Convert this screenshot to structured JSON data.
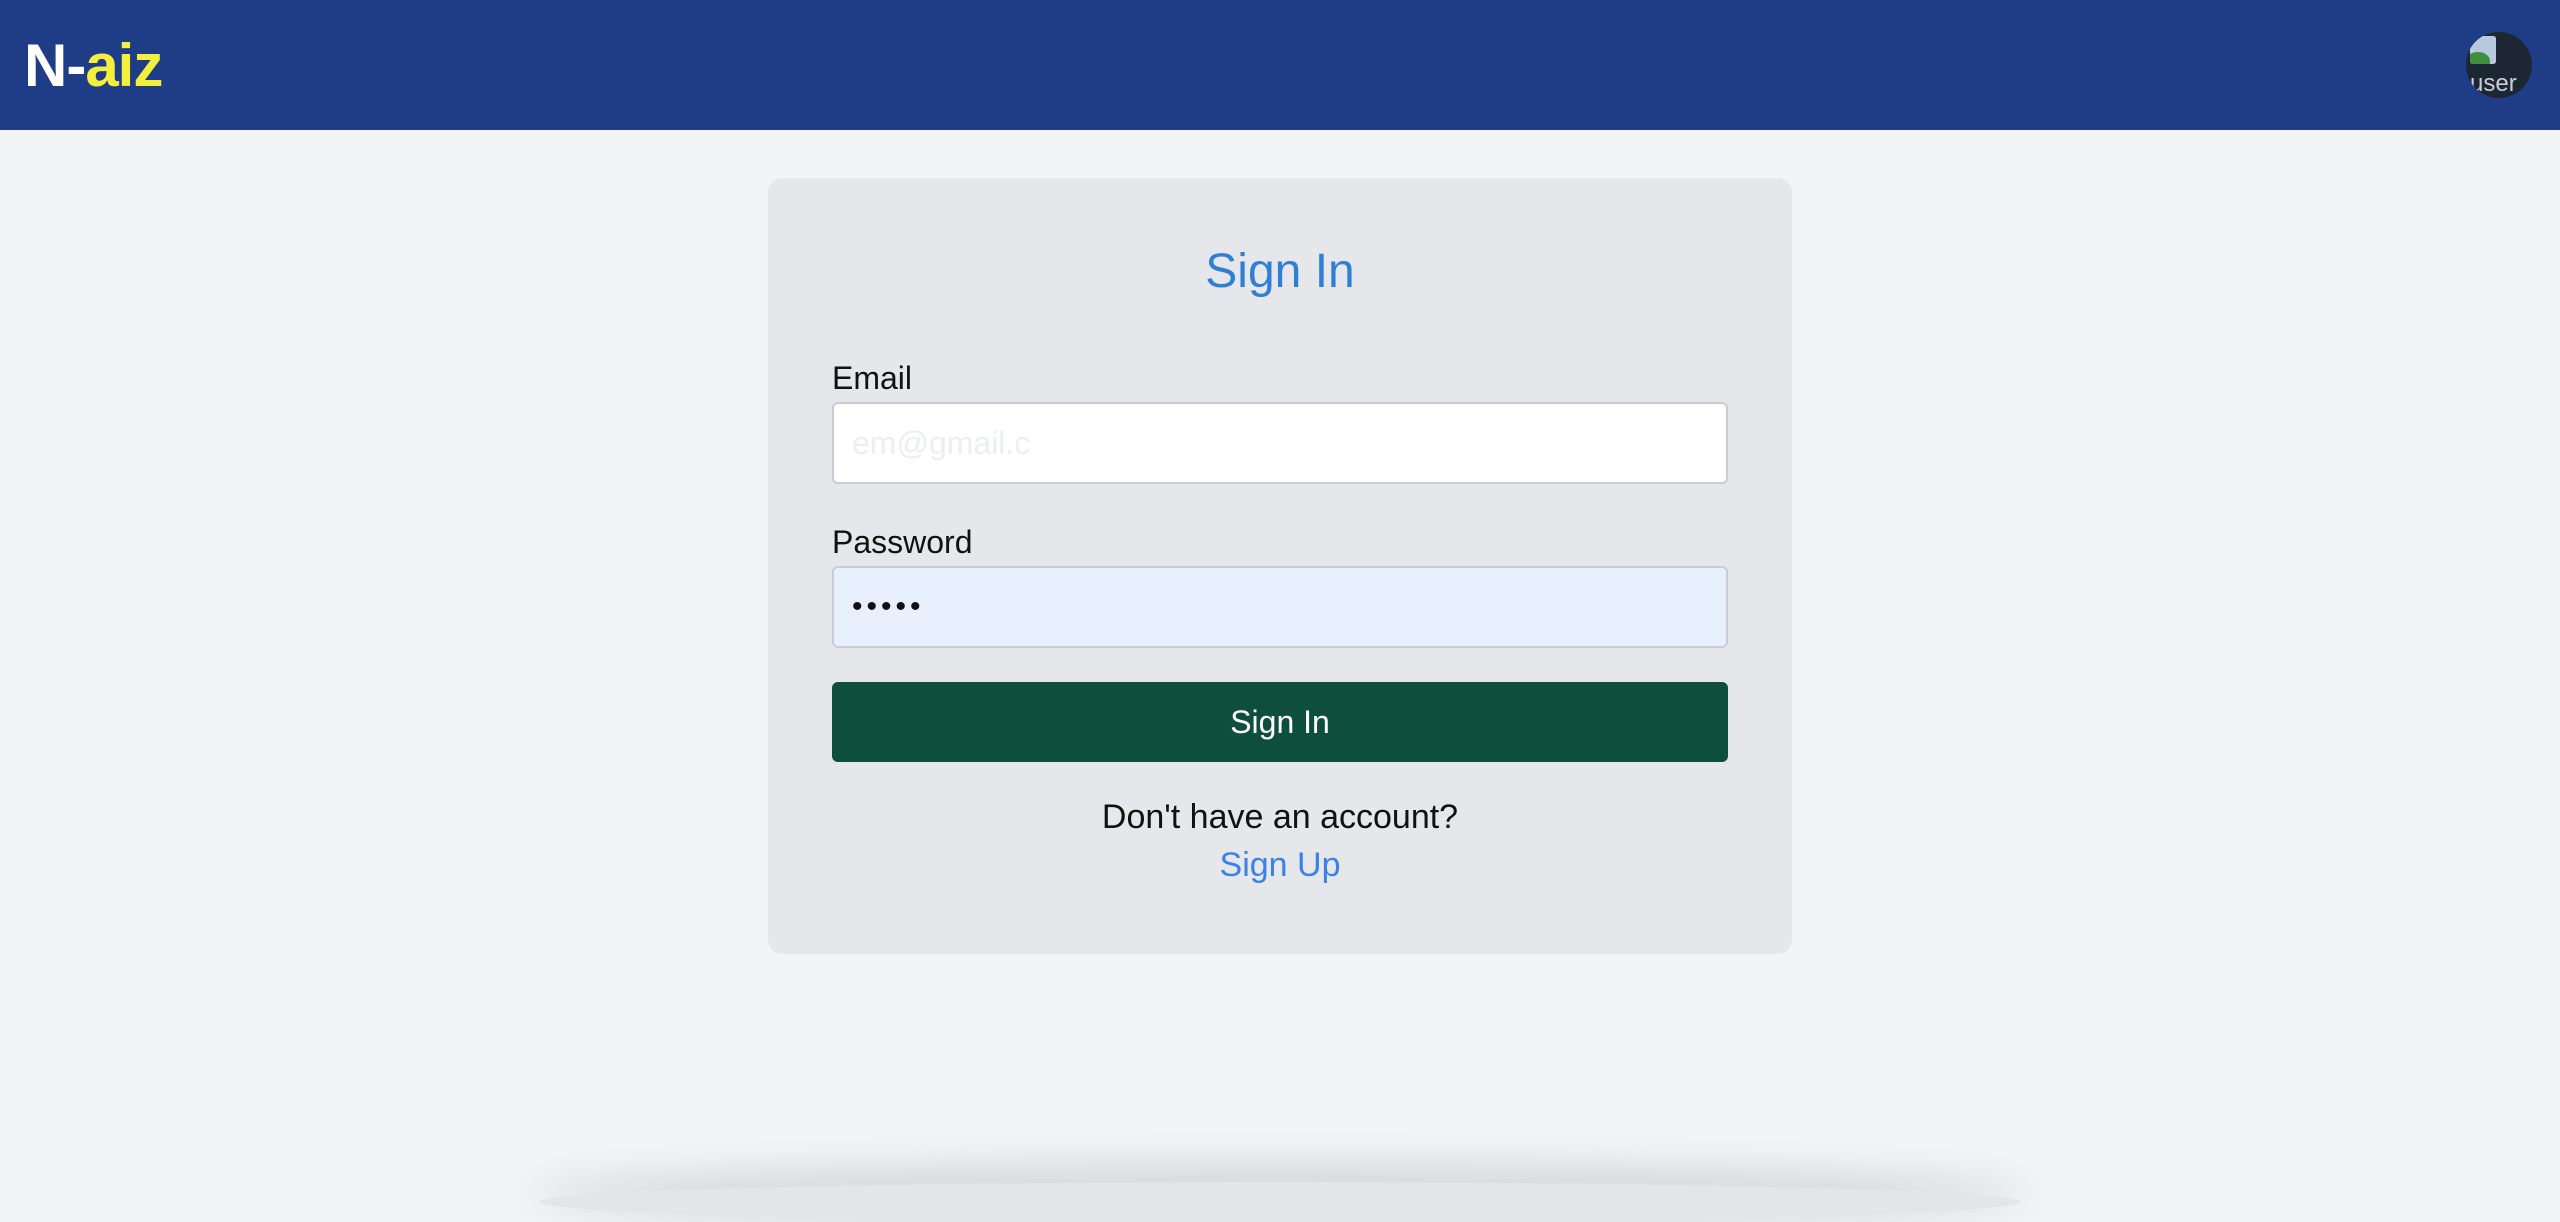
{
  "navbar": {
    "logo_main": "N-",
    "logo_accent": "aiz",
    "avatar_alt": "user",
    "colors": {
      "background": "#1f3d87",
      "logo_accent": "#f4ef3c"
    }
  },
  "signin": {
    "title": "Sign In",
    "email_label": "Email",
    "email_placeholder": "em@gmail.c",
    "email_value": "",
    "password_label": "Password",
    "password_value": "•••••",
    "submit_label": "Sign In",
    "prompt_text": "Don't have an account?",
    "signup_link": "Sign Up",
    "colors": {
      "title": "#2f7fd6",
      "button": "#0d4f3c",
      "link": "#3b82e6",
      "card": "#e5e7eb"
    }
  }
}
